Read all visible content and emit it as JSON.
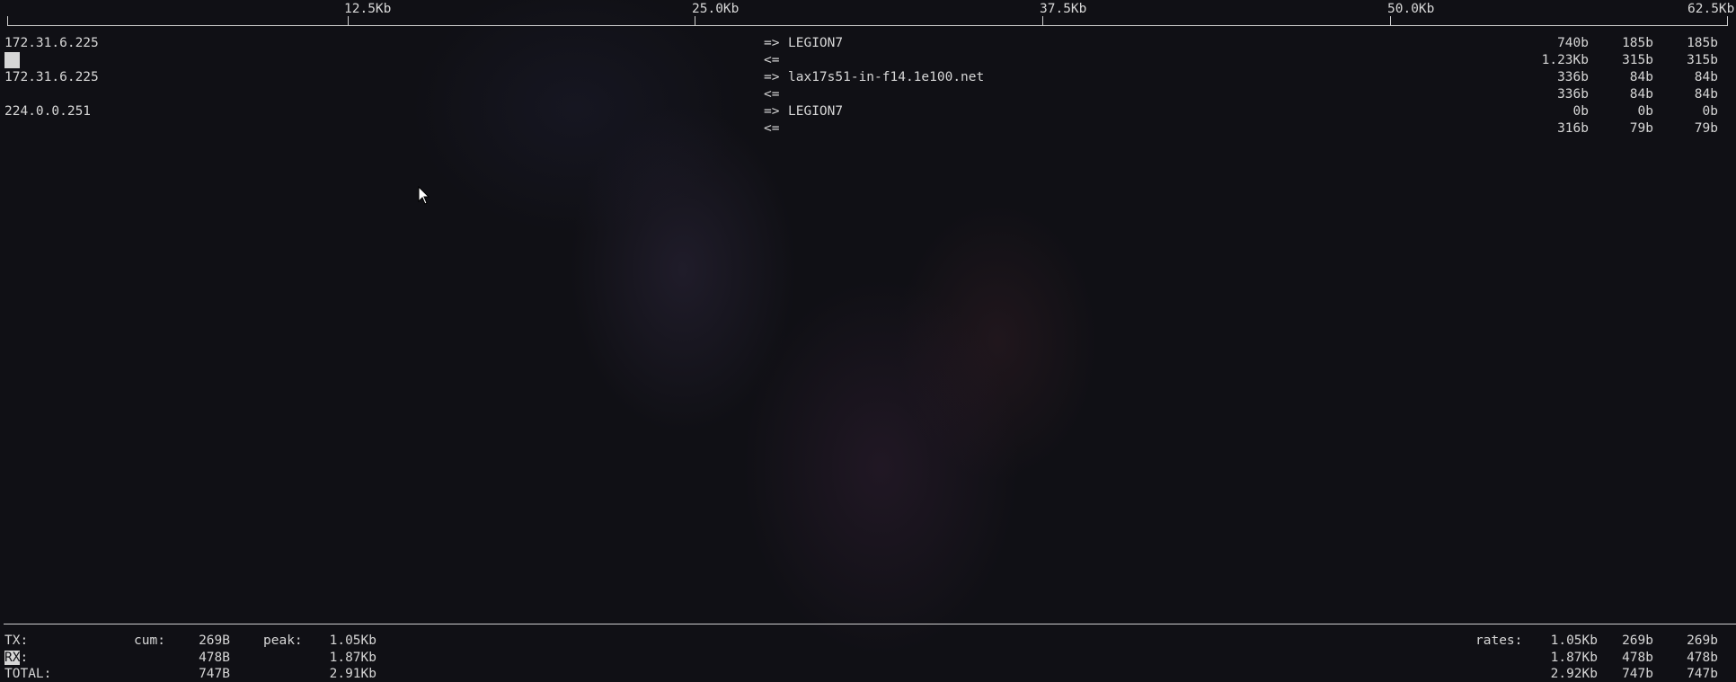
{
  "scale": {
    "ticks": [
      "12.5Kb",
      "25.0Kb",
      "37.5Kb",
      "50.0Kb",
      "62.5Kb"
    ]
  },
  "rows": [
    {
      "host": "172.31.6.225",
      "dir": "=>",
      "peer": "LEGION7",
      "r1": "740b",
      "r2": "185b",
      "r3": "185b"
    },
    {
      "host": "",
      "dir": "<=",
      "peer": "",
      "r1": "1.23Kb",
      "r2": "315b",
      "r3": "315b"
    },
    {
      "host": "172.31.6.225",
      "dir": "=>",
      "peer": "lax17s51-in-f14.1e100.net",
      "r1": "336b",
      "r2": "84b",
      "r3": "84b"
    },
    {
      "host": "",
      "dir": "<=",
      "peer": "",
      "r1": "336b",
      "r2": "84b",
      "r3": "84b"
    },
    {
      "host": "224.0.0.251",
      "dir": "=>",
      "peer": "LEGION7",
      "r1": "0b",
      "r2": "0b",
      "r3": "0b"
    },
    {
      "host": "",
      "dir": "<=",
      "peer": "",
      "r1": "316b",
      "r2": "79b",
      "r3": "79b"
    }
  ],
  "footer": {
    "tx_label": "TX:",
    "rx_label": "RX",
    "rx_colon": ":",
    "total_label": "TOTAL:",
    "cum_label": "cum:",
    "peak_label": "peak:",
    "rates_label": "rates:",
    "tx_cum": "269B",
    "rx_cum": "478B",
    "total_cum": "747B",
    "tx_peak": "1.05Kb",
    "rx_peak": "1.87Kb",
    "total_peak": "2.91Kb",
    "tx_rates": [
      "1.05Kb",
      "269b",
      "269b"
    ],
    "rx_rates": [
      "1.87Kb",
      "478b",
      "478b"
    ],
    "total_rates": [
      "2.92Kb",
      "747b",
      "747b"
    ]
  }
}
